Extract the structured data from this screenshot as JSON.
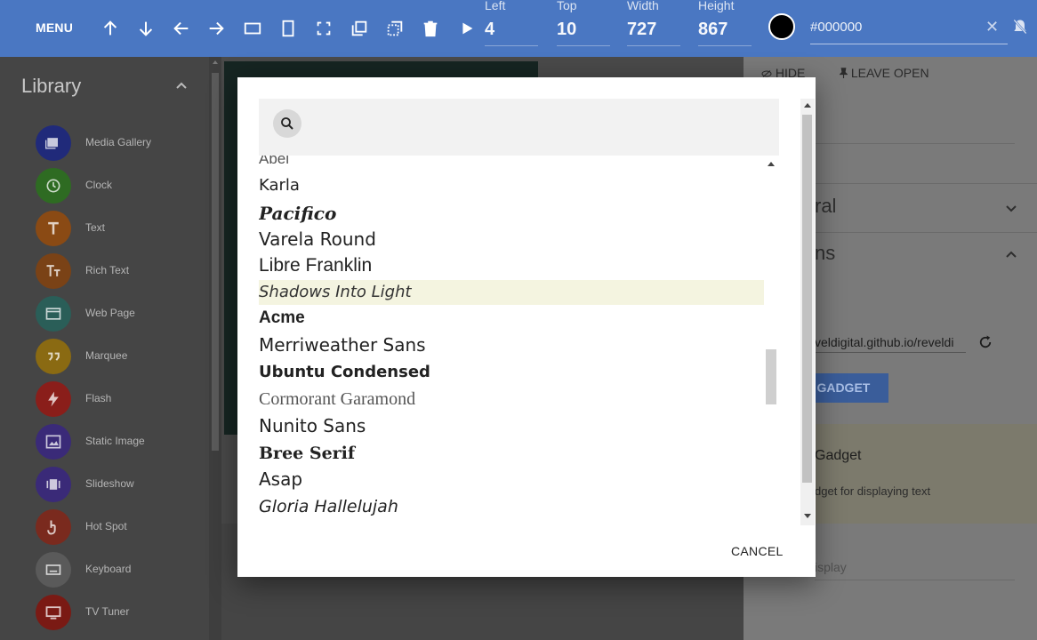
{
  "toolbar": {
    "menu_label": "MENU",
    "icons": [
      "arrow-up-icon",
      "arrow-down-icon",
      "arrow-left-icon",
      "arrow-right-icon",
      "fit-width-icon",
      "fit-height-icon",
      "fullscreen-icon",
      "bring-front-icon",
      "send-back-icon",
      "delete-icon",
      "play-icon"
    ],
    "left_label": "Left",
    "left_value": "4",
    "top_label": "Top",
    "top_value": "10",
    "width_label": "Width",
    "width_value": "727",
    "height_label": "Height",
    "height_value": "867",
    "color_value": "#000000",
    "accent_color": "#4a77c2"
  },
  "library": {
    "title": "Library",
    "items": [
      {
        "label": "Media Gallery",
        "icon": "media-gallery-icon",
        "color": "#202a7a"
      },
      {
        "label": "Clock",
        "icon": "clock-icon",
        "color": "#2e6b22"
      },
      {
        "label": "Text",
        "icon": "text-icon",
        "color": "#8a4a14"
      },
      {
        "label": "Rich Text",
        "icon": "rich-text-icon",
        "color": "#7a4216"
      },
      {
        "label": "Web Page",
        "icon": "web-page-icon",
        "color": "#2a5e58"
      },
      {
        "label": "Marquee",
        "icon": "marquee-icon",
        "color": "#8a6a12"
      },
      {
        "label": "Flash",
        "icon": "flash-icon",
        "color": "#8a1e1a"
      },
      {
        "label": "Static Image",
        "icon": "static-image-icon",
        "color": "#3a2a78"
      },
      {
        "label": "Slideshow",
        "icon": "slideshow-icon",
        "color": "#3a2a78"
      },
      {
        "label": "Hot Spot",
        "icon": "hot-spot-icon",
        "color": "#7a2a1e"
      },
      {
        "label": "Keyboard",
        "icon": "keyboard-icon",
        "color": "#5a5a5a"
      },
      {
        "label": "TV Tuner",
        "icon": "tv-tuner-icon",
        "color": "#7a1a14"
      }
    ]
  },
  "props": {
    "hide_label": "HIDE",
    "leave_open_label": "LEAVE OPEN",
    "general_label": "ral",
    "options_label": "ns",
    "url_value": "veldigital.github.io/reveldi",
    "gadget_button": "T GADGET",
    "info_title": "Gadget",
    "info_desc": "dget for displaying text",
    "display_field": "isplay"
  },
  "modal": {
    "fonts": [
      {
        "name": "Abel",
        "family": "\"Liberation Sans\", sans-serif",
        "size": 17,
        "weight": "normal",
        "style": "normal",
        "color": "#555"
      },
      {
        "name": "Karla",
        "family": "\"DejaVu Sans\", sans-serif",
        "size": 18,
        "weight": "normal",
        "style": "normal",
        "color": "#222"
      },
      {
        "name": "Pacifico",
        "family": "\"DejaVu Serif\", serif",
        "size": 20,
        "weight": "bold",
        "style": "italic",
        "color": "#222"
      },
      {
        "name": "Varela Round",
        "family": "\"DejaVu Sans\", sans-serif",
        "size": 20,
        "weight": "normal",
        "style": "normal",
        "color": "#222"
      },
      {
        "name": "Libre Franklin",
        "family": "\"Liberation Sans\", sans-serif",
        "size": 21,
        "weight": "normal",
        "style": "normal",
        "color": "#222"
      },
      {
        "name": "Shadows Into Light",
        "family": "\"DejaVu Sans\", sans-serif",
        "size": 18,
        "weight": "normal",
        "style": "italic",
        "color": "#333"
      },
      {
        "name": "Acme",
        "family": "\"Liberation Sans\", sans-serif",
        "size": 19,
        "weight": "bold",
        "style": "normal",
        "color": "#222"
      },
      {
        "name": "Merriweather Sans",
        "family": "\"DejaVu Sans\", sans-serif",
        "size": 20,
        "weight": "normal",
        "style": "normal",
        "color": "#222"
      },
      {
        "name": "Ubuntu Condensed",
        "family": "\"DejaVu Sans\", sans-serif",
        "size": 18,
        "weight": "bold",
        "style": "normal",
        "color": "#222"
      },
      {
        "name": "Cormorant Garamond",
        "family": "\"Liberation Serif\", serif",
        "size": 20,
        "weight": "normal",
        "style": "normal",
        "color": "#555"
      },
      {
        "name": "Nunito Sans",
        "family": "\"DejaVu Sans\", sans-serif",
        "size": 20,
        "weight": "normal",
        "style": "normal",
        "color": "#222"
      },
      {
        "name": "Bree Serif",
        "family": "\"DejaVu Serif\", serif",
        "size": 19,
        "weight": "bold",
        "style": "normal",
        "color": "#222"
      },
      {
        "name": "Asap",
        "family": "\"DejaVu Sans\", sans-serif",
        "size": 20,
        "weight": "normal",
        "style": "normal",
        "color": "#222"
      },
      {
        "name": "Gloria Hallelujah",
        "family": "\"DejaVu Sans\", sans-serif",
        "size": 19,
        "weight": "normal",
        "style": "italic",
        "color": "#222"
      }
    ],
    "selected_font": "Shadows Into Light",
    "cancel_label": "CANCEL"
  }
}
